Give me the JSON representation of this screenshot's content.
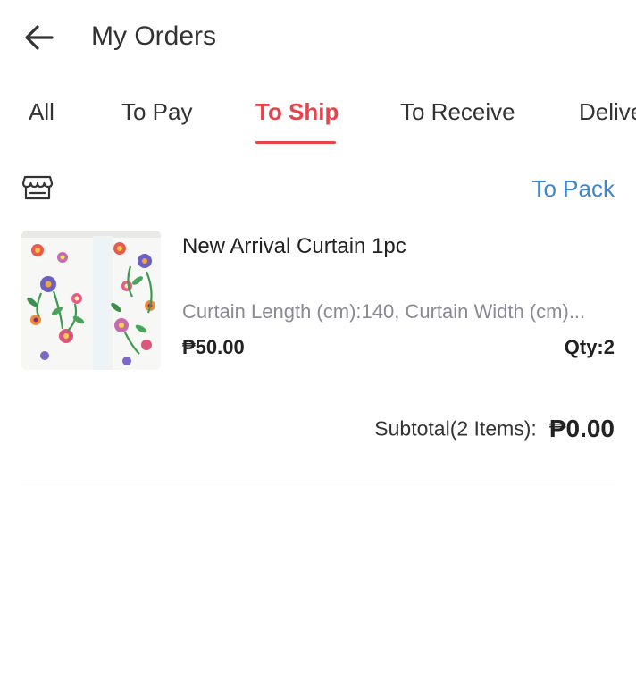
{
  "header": {
    "title": "My Orders",
    "back_icon": "arrow-left-icon"
  },
  "tabs": [
    {
      "label": "All",
      "active": false
    },
    {
      "label": "To Pay",
      "active": false
    },
    {
      "label": "To Ship",
      "active": true
    },
    {
      "label": "To Receive",
      "active": false
    },
    {
      "label": "Delivered",
      "active": false
    }
  ],
  "order": {
    "shop_icon": "store-icon",
    "status": "To Pack",
    "item": {
      "name": "New Arrival Curtain 1pc",
      "variant": "Curtain Length (cm):140, Curtain Width (cm)...",
      "price": "₱50.00",
      "qty": "Qty:2"
    },
    "subtotal_label": "Subtotal(2 Items):",
    "subtotal_value": "₱0.00"
  },
  "colors": {
    "accent": "#e8434d",
    "status": "#3f86d2",
    "muted_text": "#8a8a96"
  }
}
